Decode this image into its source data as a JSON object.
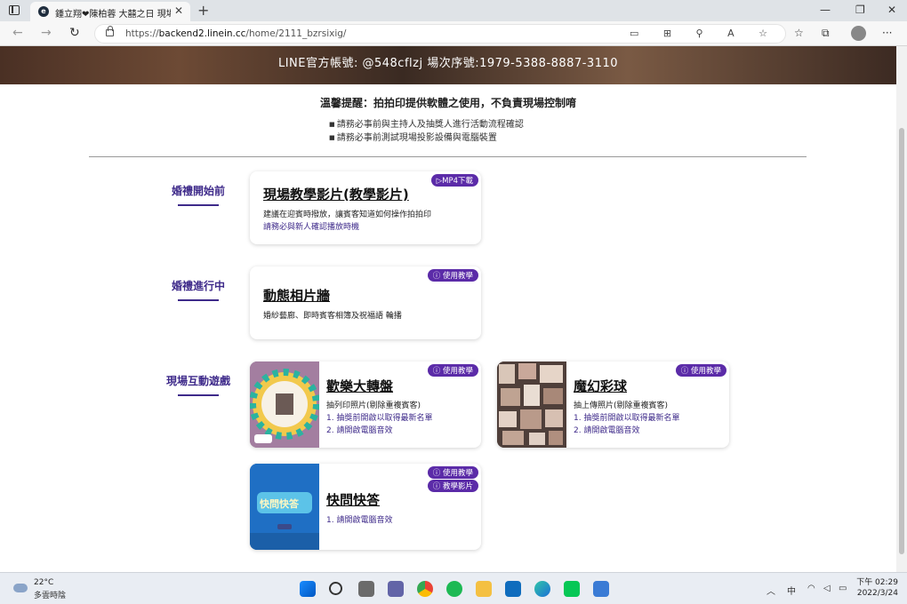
{
  "browser": {
    "tab_title": "鍾立翔❤陳柏蓉 大囍之日 現場互動",
    "tab_close": "✕",
    "new_tab": "+",
    "url_prefix": "https://",
    "url_host": "backend2.linein.cc",
    "url_path": "/home/2111_bzrsixig/",
    "back": "←",
    "forward": "→",
    "reload": "↻",
    "more": "···",
    "minimize": "—",
    "maximize": "❐",
    "close": "✕"
  },
  "banner": {
    "text": "LINE官方帳號: @548cflzj    場次序號:1979-5388-8887-3110"
  },
  "notice": {
    "title": "溫馨提醒：拍拍印提供軟體之使用，不負責現場控制唷",
    "bullets": [
      "請務必事前與主持人及抽獎人進行活動流程確認",
      "請務必事前測試現場投影設備與電腦裝置"
    ]
  },
  "sections": {
    "before": "婚禮開始前",
    "during": "婚禮進行中",
    "games": "現場互動遊戲"
  },
  "cards": {
    "video": {
      "badge": "▷MP4下載",
      "title": "現場教學影片(教學影片)",
      "desc": "建議在迎賓時撥放，讓賓客知道如何操作拍拍印",
      "note": "請務必與新人確認播放時機"
    },
    "wall": {
      "badge": "ⓘ 使用教學",
      "title": "動態相片牆",
      "desc": "婚紗藝廊、即時賓客相簿及祝福語 輪播"
    },
    "wheel": {
      "badge": "ⓘ 使用教學",
      "title": "歡樂大轉盤",
      "desc": "抽列印照片(剔除重複賓客)",
      "notes": [
        "1. 抽獎前開啟以取得最新名單",
        "2. 請開啟電腦音效"
      ]
    },
    "ball": {
      "badge": "ⓘ 使用教學",
      "title": "魔幻彩球",
      "desc": "抽上傳照片(剔除重複賓客)",
      "notes": [
        "1. 抽獎前開啟以取得最新名單",
        "2. 請開啟電腦音效"
      ]
    },
    "quiz": {
      "badge1": "ⓘ 使用教學",
      "badge2": "ⓘ 教學影片",
      "title": "快問快答",
      "note": "1. 請開啟電腦音效",
      "thumb_text": "快問快答"
    }
  },
  "taskbar": {
    "temp": "22°C",
    "weather": "多雲時陰",
    "ime": "中",
    "time": "下午 02:29",
    "date": "2022/3/24"
  },
  "colors": {
    "accent": "#5b2ba8",
    "section_text": "#3e2a8a"
  }
}
